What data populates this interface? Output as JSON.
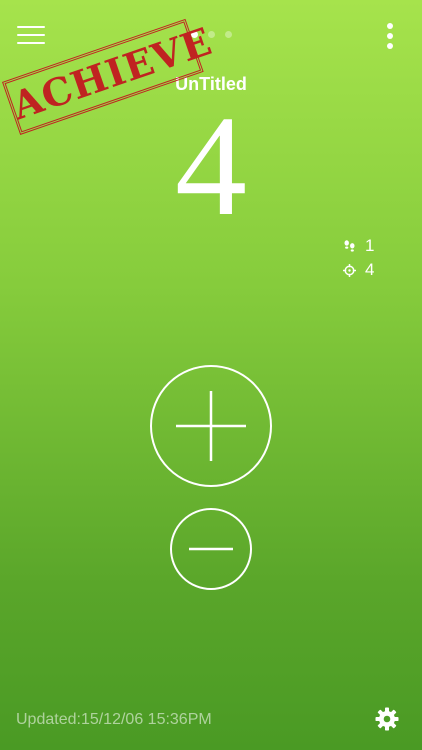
{
  "header": {
    "title": "UnTitled",
    "menu_icon": "hamburger-menu-icon",
    "more_icon": "vertical-ellipsis-icon",
    "page_dots": {
      "count": 3,
      "active_index": 0
    }
  },
  "stamp": {
    "text": "ACHIEVE",
    "color": "#c3141e"
  },
  "counter": {
    "value": "4"
  },
  "stats": [
    {
      "icon": "footsteps-icon",
      "value": "1"
    },
    {
      "icon": "target-crosshair-icon",
      "value": "4"
    }
  ],
  "controls": {
    "increment_icon": "plus-icon",
    "decrement_icon": "minus-icon"
  },
  "footer": {
    "updated_label": "Updated:15/12/06 15:36PM",
    "settings_icon": "gear-icon"
  },
  "colors": {
    "background_top": "#a6e34c",
    "background_bottom": "#4a9a24",
    "foreground": "#ffffff"
  }
}
